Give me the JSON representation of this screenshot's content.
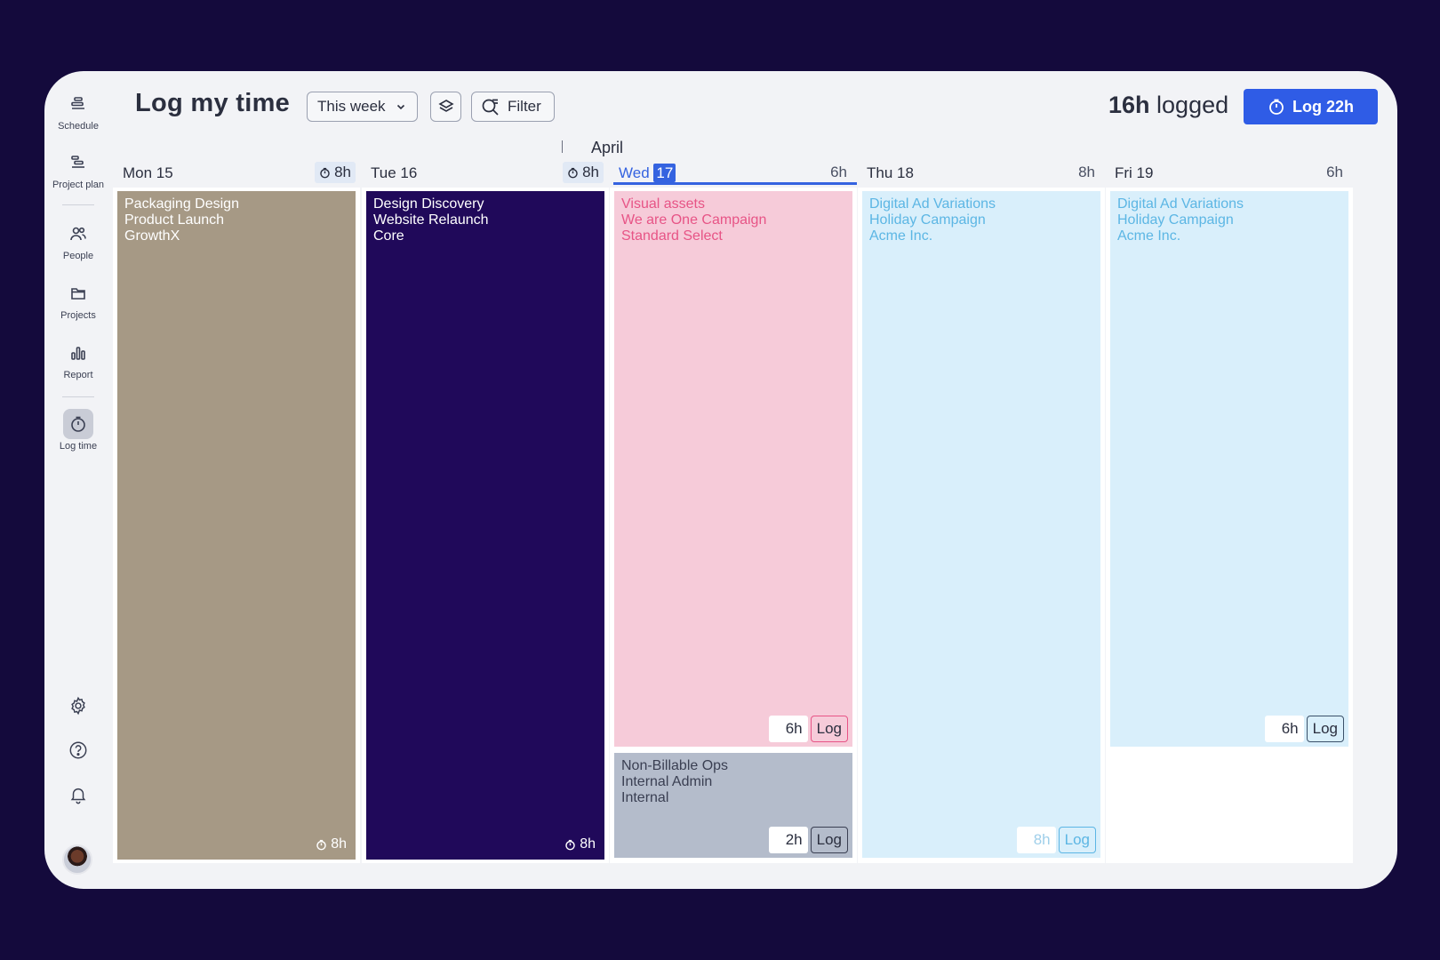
{
  "sidebar": {
    "items": [
      {
        "label": "Schedule",
        "icon": "schedule-icon"
      },
      {
        "label": "Project plan",
        "icon": "project-plan-icon"
      },
      {
        "label": "People",
        "icon": "people-icon"
      },
      {
        "label": "Projects",
        "icon": "folder-icon"
      },
      {
        "label": "Report",
        "icon": "bar-chart-icon"
      },
      {
        "label": "Log time",
        "icon": "clock-icon",
        "active": true
      }
    ],
    "utilities": [
      "gear-icon",
      "help-icon",
      "bell-icon"
    ]
  },
  "header": {
    "title": "Log my time",
    "week_select": "This week",
    "filter_label": "Filter",
    "logged_hours": "16h",
    "logged_suffix": " logged",
    "log_button": "Log 22h"
  },
  "calendar": {
    "month": "April",
    "days": [
      {
        "name": "Mon 15",
        "hours": "8h",
        "entries": [
          {
            "line1": "Packaging Design",
            "line2": "Product Launch",
            "line3": "GrowthX",
            "footer": "8h",
            "bg": "#a69985",
            "fg": "#ffffff"
          }
        ]
      },
      {
        "name": "Tue 16",
        "hours": "8h",
        "entries": [
          {
            "line1": "Design Discovery",
            "line2": "Website Relaunch",
            "line3": "Core",
            "footer": "8h",
            "bg": "#20095a",
            "fg": "#ffffff"
          }
        ]
      },
      {
        "name_prefix": "Wed",
        "name_num": "17",
        "hours": "6h",
        "today": true,
        "entries": [
          {
            "line1": "Visual assets",
            "line2": "We are One Campaign",
            "line3": "Standard Select",
            "hours": "6h",
            "log": "Log",
            "bg": "#f6cbd9",
            "fg": "#e75486"
          },
          {
            "line1": "Non-Billable Ops",
            "line2": "Internal Admin",
            "line3": "Internal",
            "hours": "2h",
            "log": "Log",
            "bg": "#b4bccb",
            "fg": "#3a3f52"
          }
        ]
      },
      {
        "name": "Thu 18",
        "hours": "8h",
        "entries": [
          {
            "line1": "Digital Ad Variations",
            "line2": "Holiday Campaign",
            "line3": "Acme Inc.",
            "hours": "8h",
            "log": "Log",
            "bg": "#d9effb",
            "fg": "#5cb6e4"
          }
        ]
      },
      {
        "name": "Fri 19",
        "hours": "6h",
        "entries": [
          {
            "line1": "Digital Ad Variations",
            "line2": "Holiday Campaign",
            "line3": "Acme Inc.",
            "hours": "6h",
            "log": "Log",
            "bg": "#d9effb",
            "fg": "#5cb6e4"
          }
        ]
      }
    ]
  }
}
